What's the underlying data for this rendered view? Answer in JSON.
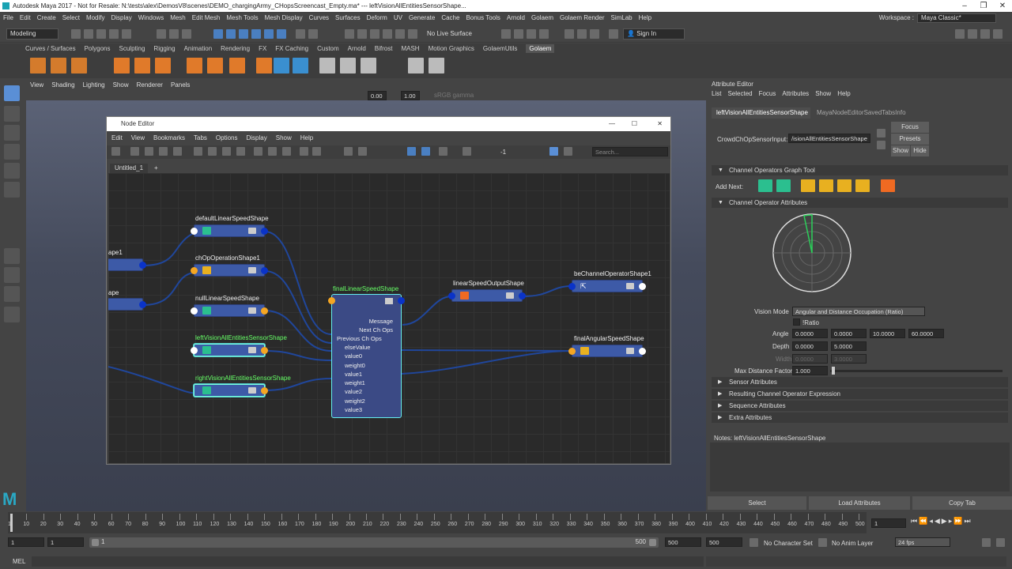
{
  "window": {
    "title": "Autodesk Maya 2017 - Not for Resale: N:\\tests\\alex\\DemosV8\\scenes\\DEMO_chargingArmy_CHopsScreencast_Empty.ma*   ---   leftVisionAllEntitiesSensorShape..."
  },
  "menubar": [
    "File",
    "Edit",
    "Create",
    "Select",
    "Modify",
    "Display",
    "Windows",
    "Mesh",
    "Edit Mesh",
    "Mesh Tools",
    "Mesh Display",
    "Curves",
    "Surfaces",
    "Deform",
    "UV",
    "Generate",
    "Cache",
    "Bonus Tools",
    "Arnold",
    "Golaem",
    "Golaem Render",
    "SimLab",
    "Help"
  ],
  "toolbar": {
    "mode": "Modeling",
    "live_surface": "No Live Surface",
    "sign_in": "Sign In",
    "workspace_label": "Workspace :",
    "workspace": "Maya Classic*"
  },
  "shelf_tabs": [
    "Curves / Surfaces",
    "Polygons",
    "Sculpting",
    "Rigging",
    "Animation",
    "Rendering",
    "FX",
    "FX Caching",
    "Custom",
    "Arnold",
    "Bifrost",
    "MASH",
    "Motion Graphics",
    "GolaemUtils",
    "Golaem"
  ],
  "shelf_active": "Golaem",
  "viewport_menu": [
    "View",
    "Shading",
    "Lighting",
    "Show",
    "Renderer",
    "Panels"
  ],
  "viewport_values": {
    "exposure": "0.00",
    "gamma": "1.00",
    "colorspace": "sRGB gamma"
  },
  "node_editor": {
    "title": "Node Editor",
    "menu": [
      "Edit",
      "View",
      "Bookmarks",
      "Tabs",
      "Options",
      "Display",
      "Show",
      "Help"
    ],
    "search_placeholder": "Search...",
    "tab": "Untitled_1",
    "tab_add": "+",
    "minus_one": "-1",
    "nodes": {
      "n1": "defaultLinearSpeedShape",
      "n2": "chOpOperationShape1",
      "n3": "nullLinearSpeedShape",
      "n4": "leftVisionAllEntitiesSensorShape",
      "n5": "rightVisionAllEntitiesSensorShape",
      "n6": "finalLinearSpeedShape",
      "n7": "linearSpeedOutputShape",
      "n8": "beChannelOperatorShape1",
      "n9": "finalAngularSpeedShape",
      "cut1": "ape1",
      "cut2": "ape"
    },
    "big_attrs": [
      "Message",
      "Next Ch Ops",
      "Previous Ch Ops",
      "elseValue",
      "value0",
      "weight0",
      "value1",
      "weight1",
      "value2",
      "weight2",
      "value3"
    ]
  },
  "attribute_editor": {
    "title": "Attribute Editor",
    "menu": [
      "List",
      "Selected",
      "Focus",
      "Attributes",
      "Show",
      "Help"
    ],
    "tab_active": "leftVisionAllEntitiesSensorShape",
    "tab_other": "MayaNodeEditorSavedTabsInfo",
    "input_label": "CrowdChOpSensorInput:",
    "input_value": "/isionAllEntitiesSensorShape",
    "btn_focus": "Focus",
    "btn_presets": "Presets",
    "btn_show": "Show",
    "btn_hide": "Hide",
    "sec1": "Channel Operators Graph Tool",
    "add_next": "Add Next:",
    "sec2": "Channel Operator Attributes",
    "vision_mode_label": "Vision Mode",
    "vision_mode": "Angular and Distance Occupation (Ratio)",
    "ratio_label": "!Ratio",
    "angle_label": "Angle",
    "angle": [
      "0.0000",
      "0.0000",
      "10.0000",
      "60.0000"
    ],
    "depth_label": "Depth",
    "depth": [
      "0.0000",
      "5.0000"
    ],
    "width_label": "Width",
    "width": [
      "0.0000",
      "3.0000"
    ],
    "maxdist_label": "Max Distance Factor",
    "maxdist": "1.000",
    "sec3": "Sensor Attributes",
    "sec4": "Resulting Channel Operator Expression",
    "sec5": "Sequence Attributes",
    "sec6": "Extra Attributes",
    "notes": "Notes:  leftVisionAllEntitiesSensorShape",
    "btn_select": "Select",
    "btn_load": "Load Attributes",
    "btn_copy": "Copy Tab"
  },
  "timeline": {
    "ticks": [
      "1",
      "10",
      "20",
      "30",
      "40",
      "50",
      "60",
      "70",
      "80",
      "90",
      "100",
      "110",
      "120",
      "130",
      "140",
      "150",
      "160",
      "170",
      "180",
      "190",
      "200",
      "210",
      "220",
      "230",
      "240",
      "250",
      "260",
      "270",
      "280",
      "290",
      "300",
      "310",
      "320",
      "330",
      "340",
      "350",
      "360",
      "370",
      "380",
      "390",
      "400",
      "410",
      "420",
      "430",
      "440",
      "450",
      "460",
      "470",
      "480",
      "490",
      "500"
    ],
    "current": "1"
  },
  "range": {
    "start": "1",
    "start2": "1",
    "slider_start": "1",
    "slider_end": "500",
    "end": "500",
    "end2": "500",
    "character_set": "No Character Set",
    "anim_layer": "No Anim Layer",
    "fps": "24 fps"
  },
  "command": {
    "label": "MEL"
  }
}
